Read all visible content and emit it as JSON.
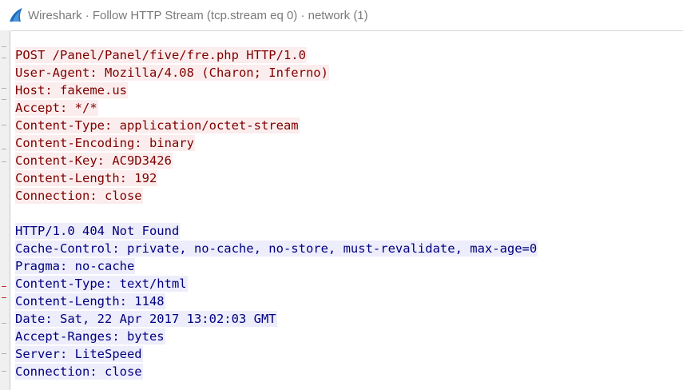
{
  "window": {
    "title": "Wireshark · Follow HTTP Stream (tcp.stream eq 0) · network (1)",
    "app_icon": "wireshark-fin-icon"
  },
  "colors": {
    "request_bg": "#fbeded",
    "request_fg": "#7f0000",
    "response_bg": "#ededfb",
    "response_fg": "#000080",
    "icon_blue": "#1f6fc0"
  },
  "stream": {
    "request_lines": [
      "POST /Panel/Panel/five/fre.php HTTP/1.0",
      "User-Agent: Mozilla/4.08 (Charon; Inferno)",
      "Host: fakeme.us",
      "Accept: */*",
      "Content-Type: application/octet-stream",
      "Content-Encoding: binary",
      "Content-Key: AC9D3426",
      "Content-Length: 192",
      "Connection: close"
    ],
    "response_lines": [
      "HTTP/1.0 404 Not Found",
      "Cache-Control: private, no-cache, no-store, must-revalidate, max-age=0",
      "Pragma: no-cache",
      "Content-Type: text/html",
      "Content-Length: 1148",
      "Date: Sat, 22 Apr 2017 13:02:03 GMT",
      "Accept-Ranges: bytes",
      "Server: LiteSpeed",
      "Connection: close"
    ]
  }
}
